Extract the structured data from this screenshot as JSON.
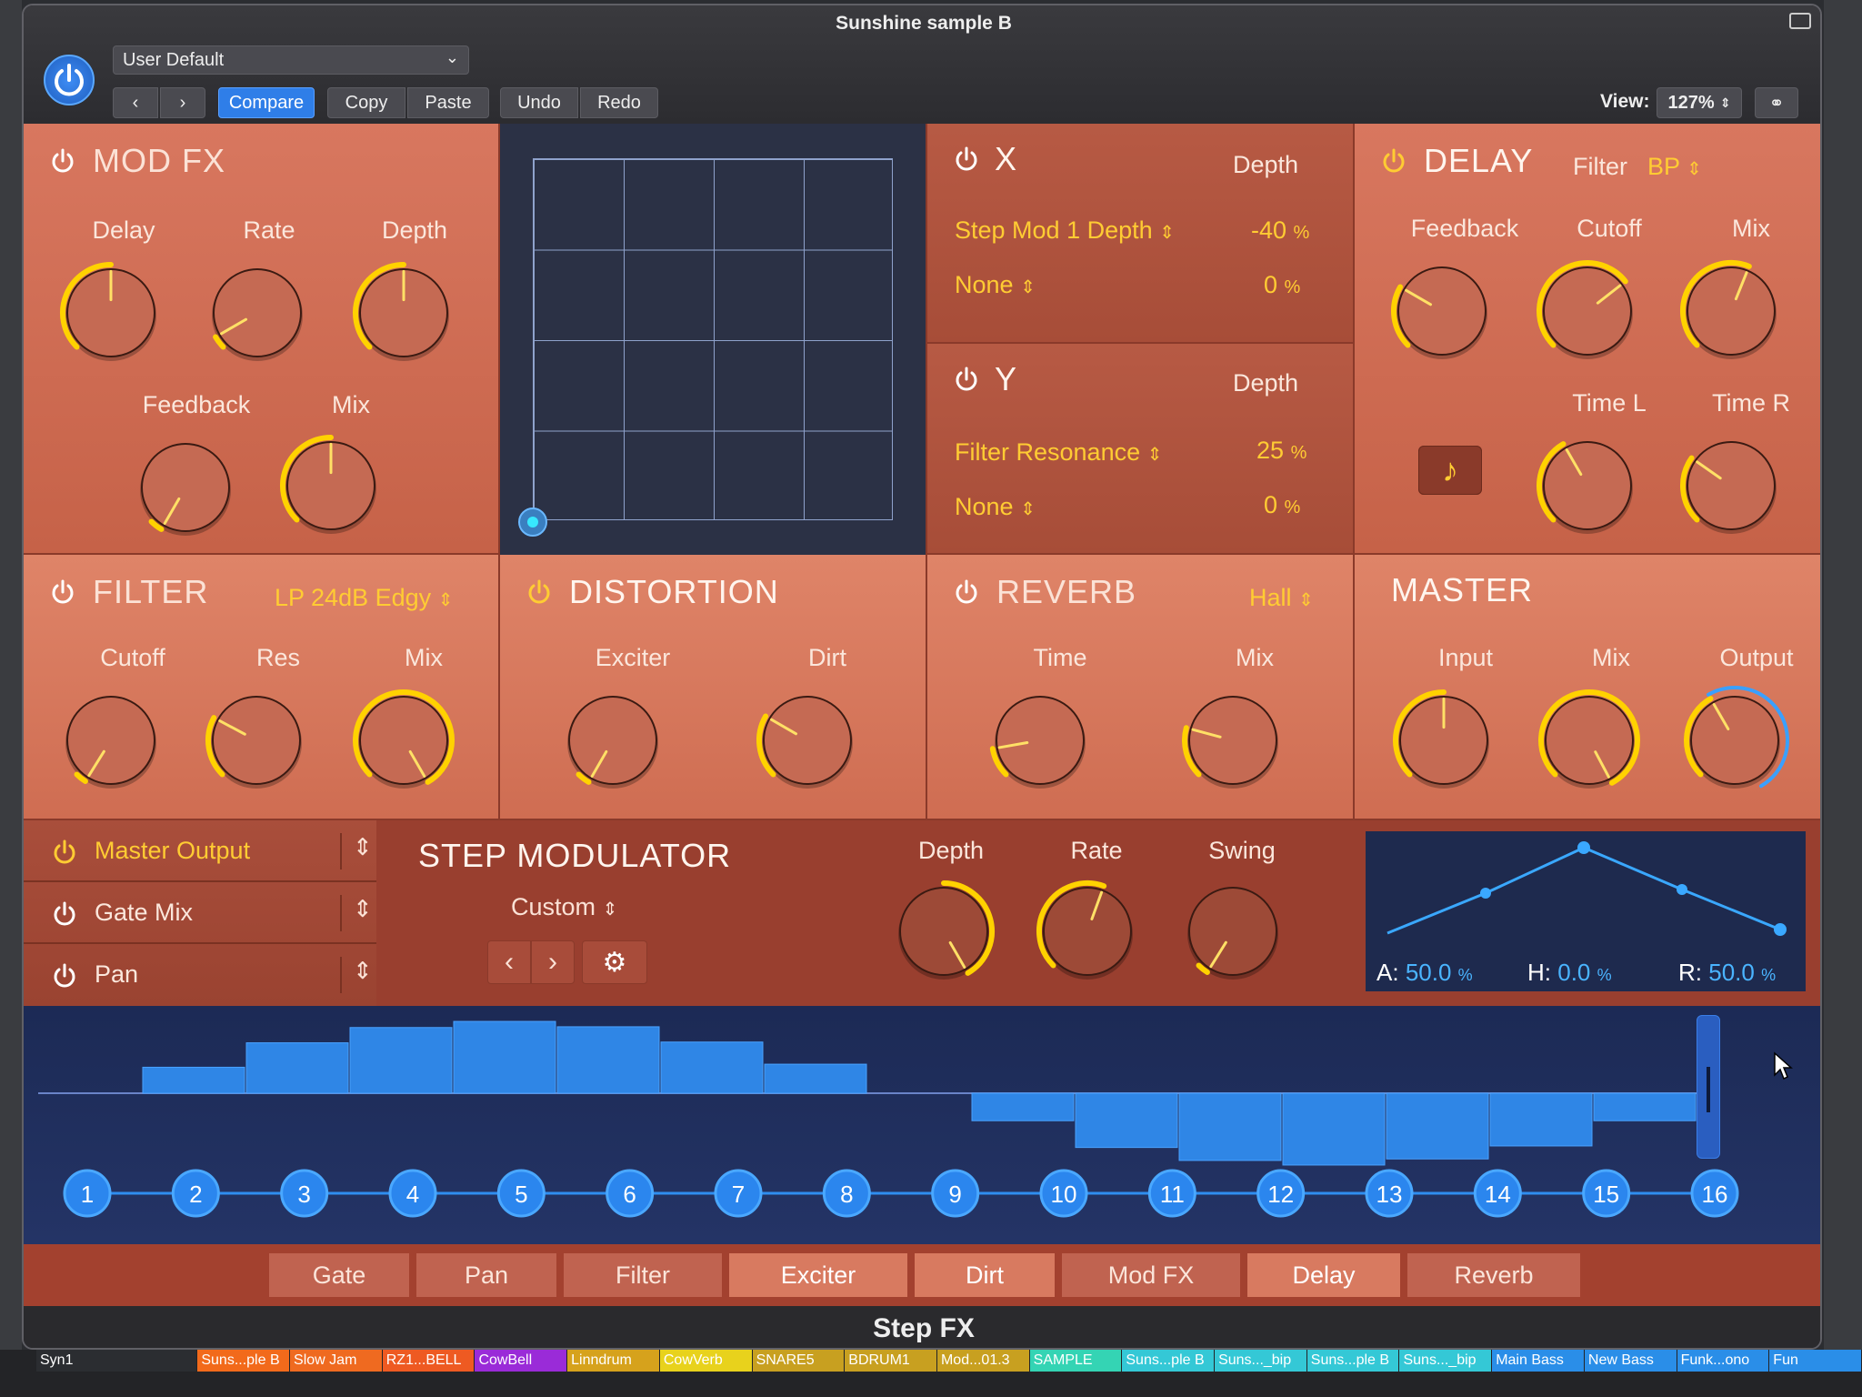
{
  "window": {
    "title": "Sunshine sample B",
    "footer_title": "Step FX"
  },
  "toolbar": {
    "preset": "User Default",
    "compare": "Compare",
    "copy": "Copy",
    "paste": "Paste",
    "undo": "Undo",
    "redo": "Redo",
    "view_label": "View:",
    "zoom": "127%"
  },
  "mod_fx": {
    "title": "MOD FX",
    "knobs": [
      "Delay",
      "Rate",
      "Depth",
      "Feedback",
      "Mix"
    ]
  },
  "x_panel": {
    "title": "X",
    "depth_label": "Depth",
    "rows": [
      {
        "target": "Step Mod 1 Depth",
        "value": "-40",
        "unit": "%"
      },
      {
        "target": "None",
        "value": "0",
        "unit": "%"
      }
    ]
  },
  "y_panel": {
    "title": "Y",
    "depth_label": "Depth",
    "rows": [
      {
        "target": "Filter Resonance",
        "value": "25",
        "unit": "%"
      },
      {
        "target": "None",
        "value": "0",
        "unit": "%"
      }
    ]
  },
  "delay": {
    "title": "DELAY",
    "filter_label": "Filter",
    "filter_value": "BP",
    "knobs": [
      "Feedback",
      "Cutoff",
      "Mix",
      "Time L",
      "Time R"
    ]
  },
  "filter": {
    "title": "FILTER",
    "mode": "LP 24dB Edgy",
    "knobs": [
      "Cutoff",
      "Res",
      "Mix"
    ]
  },
  "distortion": {
    "title": "DISTORTION",
    "knobs": [
      "Exciter",
      "Dirt"
    ]
  },
  "reverb": {
    "title": "REVERB",
    "type": "Hall",
    "knobs": [
      "Time",
      "Mix"
    ]
  },
  "master": {
    "title": "MASTER",
    "knobs": [
      "Input",
      "Mix",
      "Output"
    ]
  },
  "mod_targets": [
    "Master Output",
    "Gate Mix",
    "Pan"
  ],
  "step_mod": {
    "title": "STEP MODULATOR",
    "preset": "Custom",
    "knobs": [
      "Depth",
      "Rate",
      "Swing"
    ],
    "envelope": {
      "a_label": "A:",
      "a_value": "50.0",
      "h_label": "H:",
      "h_value": "0.0",
      "r_label": "R:",
      "r_value": "50.0",
      "unit": "%"
    }
  },
  "sequencer": {
    "steps": [
      "1",
      "2",
      "3",
      "4",
      "5",
      "6",
      "7",
      "8",
      "9",
      "10",
      "11",
      "12",
      "13",
      "14",
      "15",
      "16"
    ],
    "step_values": [
      0,
      0.34,
      0.66,
      0.86,
      0.94,
      0.87,
      0.67,
      0.38,
      0,
      -0.36,
      -0.71,
      -0.88,
      -0.94,
      -0.86,
      -0.69,
      -0.36
    ]
  },
  "tabs": [
    {
      "label": "Gate",
      "active": false
    },
    {
      "label": "Pan",
      "active": false
    },
    {
      "label": "Filter",
      "active": false
    },
    {
      "label": "Exciter",
      "active": true
    },
    {
      "label": "Dirt",
      "active": true
    },
    {
      "label": "Mod FX",
      "active": false
    },
    {
      "label": "Delay",
      "active": true
    },
    {
      "label": "Reverb",
      "active": false
    }
  ],
  "tracks": [
    {
      "label": "Syn1",
      "color": "#2b2d31"
    },
    {
      "label": "Suns...ple B",
      "color": "#f26a1b"
    },
    {
      "label": "Slow Jam",
      "color": "#ef6a20"
    },
    {
      "label": "RZ1...BELL",
      "color": "#ee5a22"
    },
    {
      "label": "CowBell",
      "color": "#9a2bd8"
    },
    {
      "label": "Linndrum",
      "color": "#d6a21c"
    },
    {
      "label": "CowVerb",
      "color": "#e8d21c"
    },
    {
      "label": "SNARE5",
      "color": "#c8a020"
    },
    {
      "label": "BDRUM1",
      "color": "#c8a020"
    },
    {
      "label": "Mod...01.3",
      "color": "#c8a020"
    },
    {
      "label": "SAMPLE",
      "color": "#34d4b4"
    },
    {
      "label": "Suns...ple B",
      "color": "#34c8d6"
    },
    {
      "label": "Suns..._bip",
      "color": "#34c8d6"
    },
    {
      "label": "Suns...ple B",
      "color": "#34c8d6"
    },
    {
      "label": "Suns..._bip",
      "color": "#34c8d6"
    },
    {
      "label": "Main Bass",
      "color": "#2a8ee8"
    },
    {
      "label": "New Bass",
      "color": "#2a8ee8"
    },
    {
      "label": "Funk...ono",
      "color": "#2a8ee8"
    },
    {
      "label": "Fun",
      "color": "#2a8ee8"
    }
  ]
}
